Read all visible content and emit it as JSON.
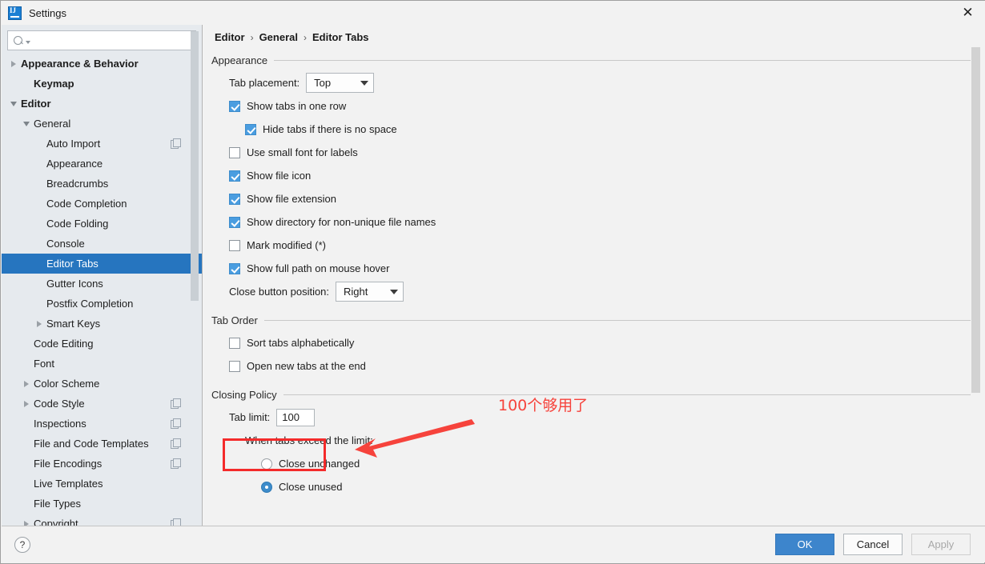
{
  "window": {
    "title": "Settings",
    "app_icon": "intellij-idea-logo",
    "close_label": "✕"
  },
  "sidebar": {
    "search": {
      "placeholder": "",
      "value": "",
      "icon": "search-icon"
    },
    "items": [
      {
        "label": "Appearance & Behavior",
        "indent": 0,
        "twisty": "right",
        "bold": true,
        "selected": false,
        "copy": false
      },
      {
        "label": "Keymap",
        "indent": 1,
        "twisty": "none",
        "bold": true,
        "selected": false,
        "copy": false
      },
      {
        "label": "Editor",
        "indent": 0,
        "twisty": "down",
        "bold": true,
        "selected": false,
        "copy": false
      },
      {
        "label": "General",
        "indent": 1,
        "twisty": "down",
        "bold": false,
        "selected": false,
        "copy": false
      },
      {
        "label": "Auto Import",
        "indent": 2,
        "twisty": "none",
        "bold": false,
        "selected": false,
        "copy": true
      },
      {
        "label": "Appearance",
        "indent": 2,
        "twisty": "none",
        "bold": false,
        "selected": false,
        "copy": false
      },
      {
        "label": "Breadcrumbs",
        "indent": 2,
        "twisty": "none",
        "bold": false,
        "selected": false,
        "copy": false
      },
      {
        "label": "Code Completion",
        "indent": 2,
        "twisty": "none",
        "bold": false,
        "selected": false,
        "copy": false
      },
      {
        "label": "Code Folding",
        "indent": 2,
        "twisty": "none",
        "bold": false,
        "selected": false,
        "copy": false
      },
      {
        "label": "Console",
        "indent": 2,
        "twisty": "none",
        "bold": false,
        "selected": false,
        "copy": false
      },
      {
        "label": "Editor Tabs",
        "indent": 2,
        "twisty": "none",
        "bold": false,
        "selected": true,
        "copy": false
      },
      {
        "label": "Gutter Icons",
        "indent": 2,
        "twisty": "none",
        "bold": false,
        "selected": false,
        "copy": false
      },
      {
        "label": "Postfix Completion",
        "indent": 2,
        "twisty": "none",
        "bold": false,
        "selected": false,
        "copy": false
      },
      {
        "label": "Smart Keys",
        "indent": 2,
        "twisty": "right",
        "bold": false,
        "selected": false,
        "copy": false
      },
      {
        "label": "Code Editing",
        "indent": 1,
        "twisty": "none",
        "bold": false,
        "selected": false,
        "copy": false
      },
      {
        "label": "Font",
        "indent": 1,
        "twisty": "none",
        "bold": false,
        "selected": false,
        "copy": false
      },
      {
        "label": "Color Scheme",
        "indent": 1,
        "twisty": "right",
        "bold": false,
        "selected": false,
        "copy": false
      },
      {
        "label": "Code Style",
        "indent": 1,
        "twisty": "right",
        "bold": false,
        "selected": false,
        "copy": true
      },
      {
        "label": "Inspections",
        "indent": 1,
        "twisty": "none",
        "bold": false,
        "selected": false,
        "copy": true
      },
      {
        "label": "File and Code Templates",
        "indent": 1,
        "twisty": "none",
        "bold": false,
        "selected": false,
        "copy": true
      },
      {
        "label": "File Encodings",
        "indent": 1,
        "twisty": "none",
        "bold": false,
        "selected": false,
        "copy": true
      },
      {
        "label": "Live Templates",
        "indent": 1,
        "twisty": "none",
        "bold": false,
        "selected": false,
        "copy": false
      },
      {
        "label": "File Types",
        "indent": 1,
        "twisty": "none",
        "bold": false,
        "selected": false,
        "copy": false
      },
      {
        "label": "Copyright",
        "indent": 1,
        "twisty": "right",
        "bold": false,
        "selected": false,
        "copy": true
      }
    ]
  },
  "breadcrumb": {
    "parts": [
      "Editor",
      "General",
      "Editor Tabs"
    ],
    "separator": "›"
  },
  "main": {
    "appearance": {
      "title": "Appearance",
      "tab_placement": {
        "label": "Tab placement:",
        "value": "Top"
      },
      "checks": [
        {
          "label": "Show tabs in one row",
          "checked": true,
          "indent": false
        },
        {
          "label": "Hide tabs if there is no space",
          "checked": true,
          "indent": true
        },
        {
          "label": "Use small font for labels",
          "checked": false,
          "indent": false
        },
        {
          "label": "Show file icon",
          "checked": true,
          "indent": false
        },
        {
          "label": "Show file extension",
          "checked": true,
          "indent": false
        },
        {
          "label": "Show directory for non-unique file names",
          "checked": true,
          "indent": false
        },
        {
          "label": "Mark modified (*)",
          "checked": false,
          "indent": false
        },
        {
          "label": "Show full path on mouse hover",
          "checked": true,
          "indent": false
        }
      ],
      "close_button_position": {
        "label": "Close button position:",
        "value": "Right"
      }
    },
    "tab_order": {
      "title": "Tab Order",
      "checks": [
        {
          "label": "Sort tabs alphabetically",
          "checked": false
        },
        {
          "label": "Open new tabs at the end",
          "checked": false
        }
      ]
    },
    "closing_policy": {
      "title": "Closing Policy",
      "tab_limit_label": "Tab limit:",
      "tab_limit_value": "100",
      "when_exceed_label": "When tabs exceed the limit:",
      "radios": [
        {
          "label": "Close unchanged",
          "selected": false
        },
        {
          "label": "Close unused",
          "selected": true
        }
      ]
    }
  },
  "annotation": {
    "text": "100个够用了",
    "color": "#f6433c",
    "box_color": "#f42b2b"
  },
  "footer": {
    "help_label": "?",
    "buttons": [
      {
        "label": "OK",
        "style": "primary"
      },
      {
        "label": "Cancel",
        "style": "normal"
      },
      {
        "label": "Apply",
        "style": "disabled"
      }
    ]
  }
}
